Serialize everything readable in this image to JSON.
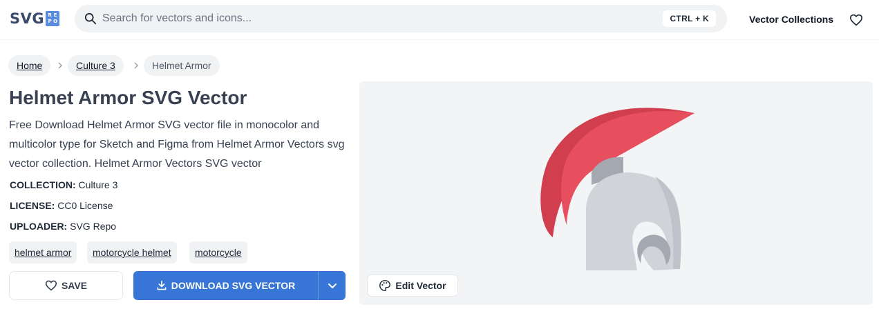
{
  "header": {
    "logo_main": "SVG",
    "logo_box": [
      "R",
      "E",
      "P",
      "O"
    ],
    "search_placeholder": "Search for vectors and icons...",
    "shortcut": "CTRL + K",
    "nav_collections": "Vector Collections",
    "favorites_icon": "heart-icon"
  },
  "breadcrumb": [
    "Home",
    "Culture 3",
    "Helmet Armor"
  ],
  "page": {
    "title": "Helmet Armor SVG Vector",
    "description": "Free Download Helmet Armor SVG vector file in monocolor and multicolor type for Sketch and Figma from Helmet Armor Vectors svg vector collection. Helmet Armor Vectors SVG vector",
    "meta": [
      {
        "label": "COLLECTION:",
        "value": "Culture 3"
      },
      {
        "label": "LICENSE:",
        "value": "CC0 License"
      },
      {
        "label": "UPLOADER:",
        "value": "SVG Repo"
      }
    ],
    "tags": [
      "helmet armor",
      "motorcycle helmet",
      "motorcycle"
    ]
  },
  "actions": {
    "save_label": "SAVE",
    "download_label": "DOWNLOAD SVG VECTOR",
    "edit_label": "Edit Vector"
  },
  "colors": {
    "accent": "#3776d6",
    "crest": "#e84f5e",
    "crest_shadow": "#d13f4e",
    "helmet": "#d1d3d9",
    "helmet_shadow": "#a4a8b1",
    "logo_box": "#5b8bdc"
  }
}
